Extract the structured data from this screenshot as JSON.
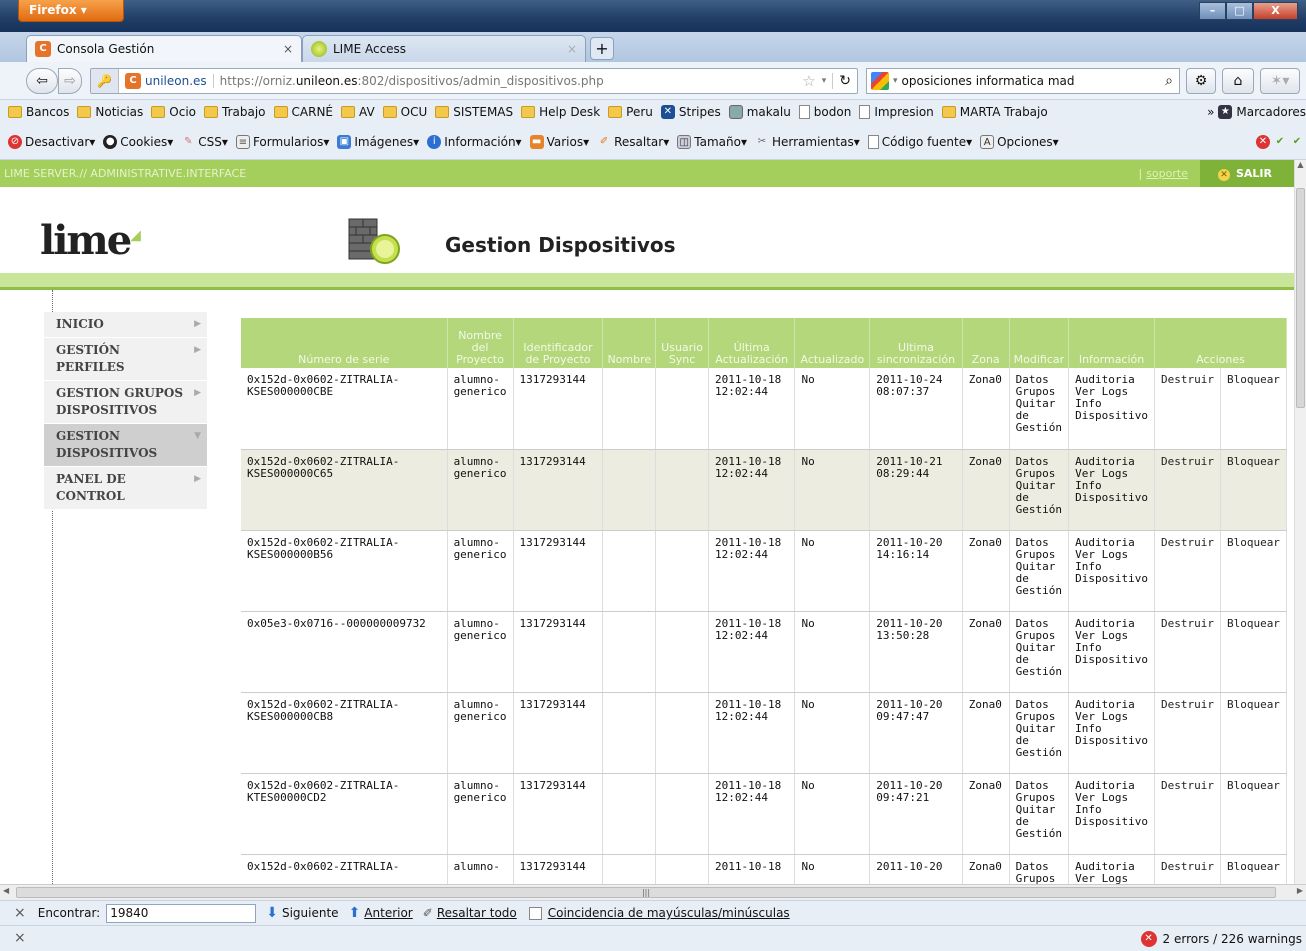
{
  "browser": {
    "app_button": "Firefox ▾",
    "tabs": [
      {
        "title": "Consola Gestión",
        "active": true
      },
      {
        "title": "LIME Access",
        "active": false
      }
    ],
    "url_domain": "unileon.es",
    "url": "https://orniz.unileon.es:802/dispositivos/admin_dispositivos.php",
    "url_pre": "https://orniz.",
    "url_host": "unileon.es",
    "url_post": ":802/dispositivos/admin_dispositivos.php",
    "search_text": "oposiciones informatica mad"
  },
  "bookmarks": [
    "Bancos",
    "Noticias",
    "Ocio",
    "Trabajo",
    "CARNÉ",
    "AV",
    "OCU",
    "SISTEMAS",
    "Help Desk",
    "Peru",
    "Stripes",
    "makalu",
    "bodon",
    "Impresion",
    "MARTA Trabajo"
  ],
  "bookmarks_more": "» ",
  "bookmarks_folder": "Marcadores",
  "webdev": [
    "Desactivar▾",
    "Cookies▾",
    "CSS▾",
    "Formularios▾",
    "Imágenes▾",
    "Información▾",
    "Varios▾",
    "Resaltar▾",
    "Tamaño▾",
    "Herramientas▾",
    "Código fuente▾",
    "Opciones▾"
  ],
  "site": {
    "topbar_text": "LIME SERVER.// ADMINISTRATIVE.INTERFACE",
    "soporte": "soporte",
    "sep": "|",
    "salir": "SALIR",
    "logo": "lime",
    "page_title": "Gestion Dispositivos",
    "sidebar": [
      {
        "label": "INICIO",
        "active": false
      },
      {
        "label": "GESTIÓN PERFILES",
        "active": false
      },
      {
        "label": "GESTION GRUPOS DISPOSITIVOS",
        "active": false
      },
      {
        "label": "GESTION DISPOSITIVOS",
        "active": true
      },
      {
        "label": "PANEL DE CONTROL",
        "active": false
      }
    ]
  },
  "table": {
    "headers": [
      "Número de serie",
      "Nombre del Proyecto",
      "Identificador de Proyecto",
      "Nombre",
      "Usuario Sync",
      "Última Actualización",
      "Actualizado",
      "Ultima sincronización",
      "Zona",
      "Modificar",
      "Información",
      "Acciones"
    ],
    "modificar": "Datos Grupos Quitar de Gestión",
    "informacion": "Auditoria Ver Logs Info Dispositivo",
    "destruir": "Destruir",
    "bloquear": "Bloquear",
    "rows": [
      {
        "serie": "0x152d-0x0602-ZITRALIA-KSES000000CBE",
        "proyecto": "alumno-generico",
        "id": "1317293144",
        "nombre": "",
        "usuario": "",
        "ultima_act": "2011-10-18 12:02:44",
        "actualizado": "No",
        "ultima_sync": "2011-10-24 08:07:37",
        "zona": "Zona0"
      },
      {
        "serie": "0x152d-0x0602-ZITRALIA-KSES000000C65",
        "proyecto": "alumno-generico",
        "id": "1317293144",
        "nombre": "",
        "usuario": "",
        "ultima_act": "2011-10-18 12:02:44",
        "actualizado": "No",
        "ultima_sync": "2011-10-21 08:29:44",
        "zona": "Zona0"
      },
      {
        "serie": "0x152d-0x0602-ZITRALIA-KSES000000B56",
        "proyecto": "alumno-generico",
        "id": "1317293144",
        "nombre": "",
        "usuario": "",
        "ultima_act": "2011-10-18 12:02:44",
        "actualizado": "No",
        "ultima_sync": "2011-10-20 14:16:14",
        "zona": "Zona0"
      },
      {
        "serie": "0x05e3-0x0716--000000009732",
        "proyecto": "alumno-generico",
        "id": "1317293144",
        "nombre": "",
        "usuario": "",
        "ultima_act": "2011-10-18 12:02:44",
        "actualizado": "No",
        "ultima_sync": "2011-10-20 13:50:28",
        "zona": "Zona0"
      },
      {
        "serie": "0x152d-0x0602-ZITRALIA-KSES000000CB8",
        "proyecto": "alumno-generico",
        "id": "1317293144",
        "nombre": "",
        "usuario": "",
        "ultima_act": "2011-10-18 12:02:44",
        "actualizado": "No",
        "ultima_sync": "2011-10-20 09:47:47",
        "zona": "Zona0"
      },
      {
        "serie": "0x152d-0x0602-ZITRALIA-KTES00000CD2",
        "proyecto": "alumno-generico",
        "id": "1317293144",
        "nombre": "",
        "usuario": "",
        "ultima_act": "2011-10-18 12:02:44",
        "actualizado": "No",
        "ultima_sync": "2011-10-20 09:47:21",
        "zona": "Zona0"
      },
      {
        "serie": "0x152d-0x0602-ZITRALIA-",
        "proyecto": "alumno-",
        "id": "1317293144",
        "nombre": "",
        "usuario": "",
        "ultima_act": "2011-10-18",
        "actualizado": "No",
        "ultima_sync": "2011-10-20",
        "zona": "Zona0"
      }
    ]
  },
  "findbar": {
    "close": "×",
    "label": "Encontrar:",
    "value": "19840",
    "next": "Siguiente",
    "prev": "Anterior",
    "highlight": "Resaltar todo",
    "match_case": "Coincidencia de mayúsculas/minúsculas"
  },
  "statusbar": {
    "close": "×",
    "errors": "2 errors / 226 warnings"
  },
  "colors": {
    "lime_green": "#a5cf5d",
    "header_green": "#b3d77a",
    "highlight_row": "#ecede0"
  }
}
